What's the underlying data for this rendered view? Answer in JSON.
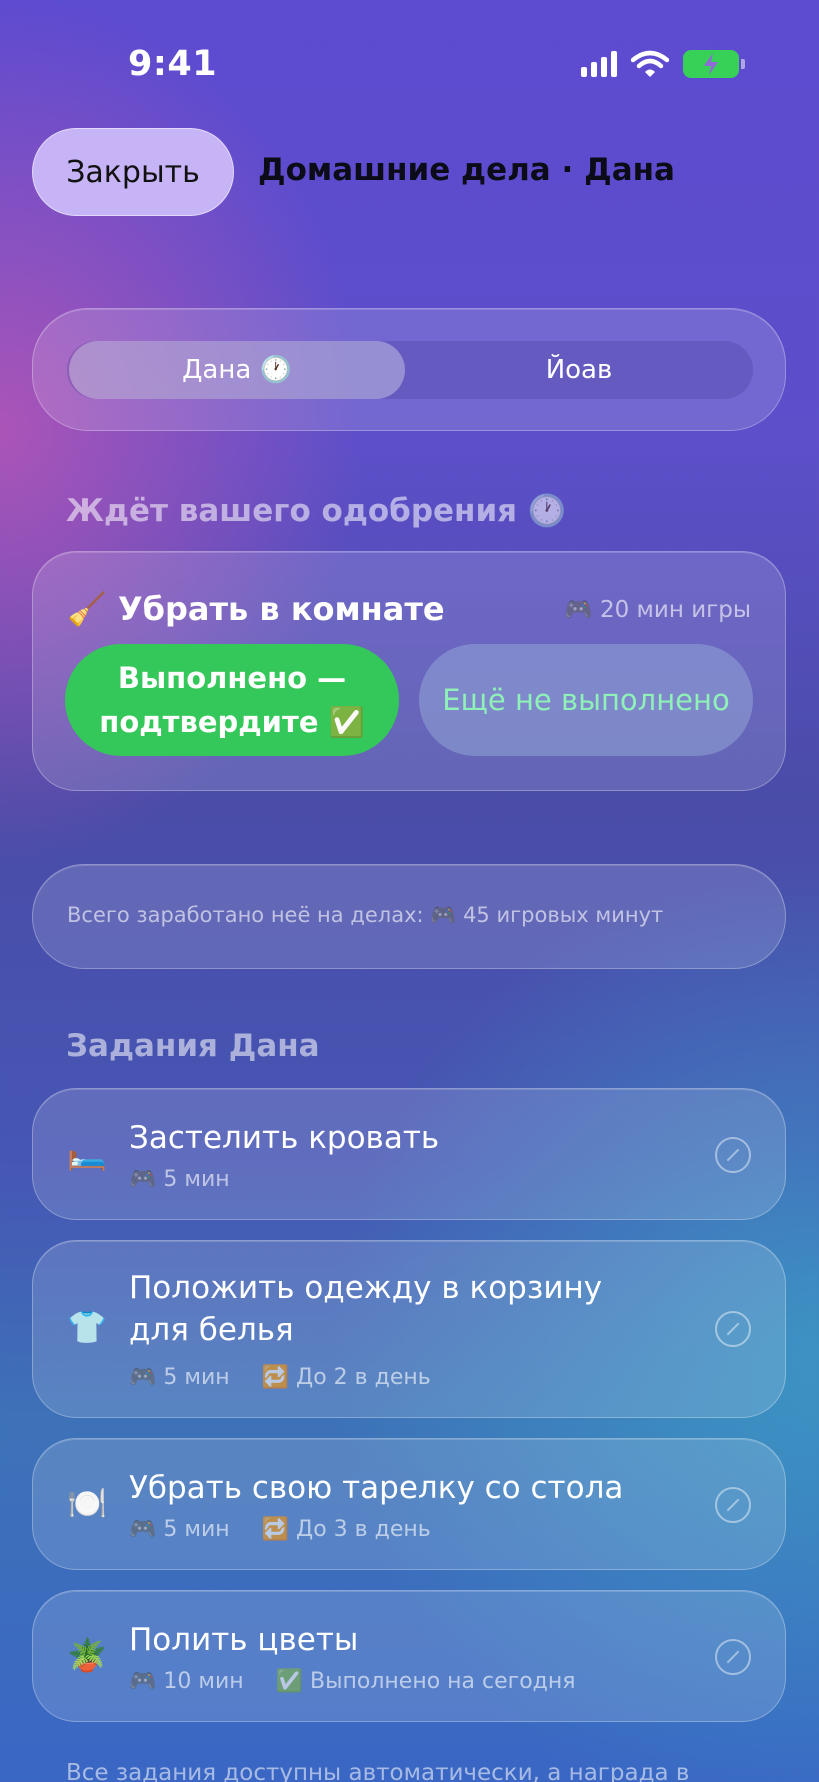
{
  "status_bar": {
    "time": "9:41"
  },
  "header": {
    "close_label": "Закрыть",
    "title": "Домашние дела · Дана"
  },
  "segmented": {
    "options": [
      {
        "label": "Дана 🕐",
        "selected": true
      },
      {
        "label": "Йоав",
        "selected": false
      }
    ]
  },
  "pending": {
    "section_title": "Ждёт вашего одобрения 🕐",
    "task_icon": "🧹",
    "task_title": "Убрать в комнате",
    "reward": "🎮 20 мин игры",
    "approve_label": "Выполнено — подтвердите ✅",
    "reject_label": "Ещё не выполнено"
  },
  "earned": {
    "text": "Всего заработано неё на делах: 🎮 45 игровых минут"
  },
  "tasks_section": {
    "title": "Задания Дана"
  },
  "tasks": [
    {
      "icon": "🛏️",
      "title": "Застелить кровать",
      "reward": "🎮 5 мин",
      "extra": ""
    },
    {
      "icon": "👕",
      "title": "Положить одежду в корзину для белья",
      "reward": "🎮 5 мин",
      "extra": "🔁 До 2 в день"
    },
    {
      "icon": "🍽️",
      "title": "Убрать свою тарелку со стола",
      "reward": "🎮 5 мин",
      "extra": "🔁 До 3 в день"
    },
    {
      "icon": "🪴",
      "title": "Полить цветы",
      "reward": "🎮 10 мин",
      "extra": "✅ Выполнено на сегодня"
    }
  ],
  "footer": {
    "note": "Все задания доступны автоматически, а награда в"
  },
  "icons": {
    "signal": "cellular-signal-icon",
    "wifi": "wifi-icon",
    "battery": "battery-charging-icon",
    "edit": "edit-pencil-icon"
  },
  "colors": {
    "accent_green": "#34c759",
    "close_button": "#c6b4f6",
    "reject_text": "#8ff0b8"
  }
}
